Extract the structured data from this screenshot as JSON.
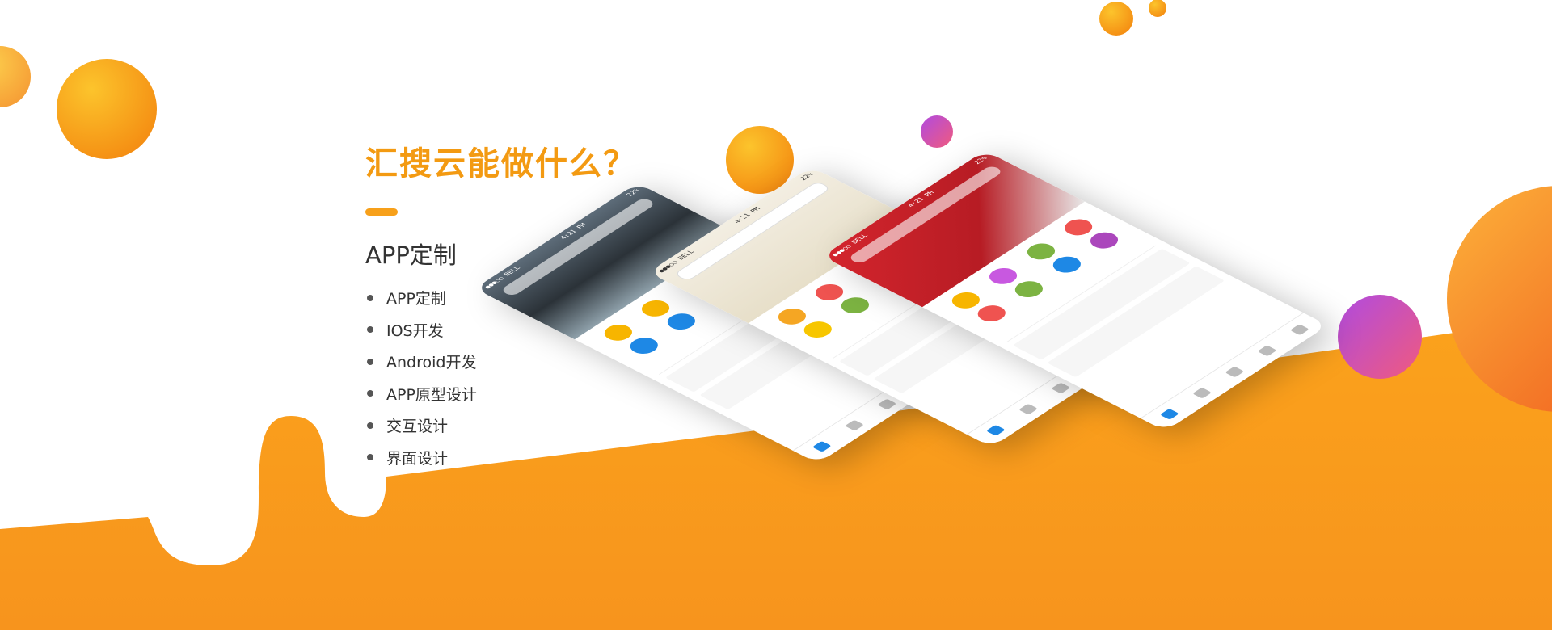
{
  "headline": "汇搜云能做什么？",
  "subtitle": "APP定制",
  "features": [
    "APP定制",
    "IOS开发",
    "Android开发",
    "APP原型设计",
    "交互设计",
    "界面设计"
  ],
  "colors": {
    "brand_orange": "#f7941d",
    "headline_orange": "#f39a12",
    "bubble_orange": "#fbb03b",
    "bubble_purple": "#9b3fd1",
    "app_red": "#d4252d",
    "tab_active_blue": "#1e88e5"
  },
  "phones": [
    {
      "status_left": "●●●○○ BELL",
      "status_time": "4:21 PM",
      "status_right": "22%",
      "tab_count": 5,
      "icon_colors": [
        "#f7b500",
        "#f7b500",
        "#f7b500",
        "#f7b500",
        "#1e88e5",
        "#1e88e5",
        "#1e88e5",
        "#1e88e5"
      ]
    },
    {
      "status_left": "●●●○○ BELL",
      "status_time": "4:21 PM",
      "status_right": "22%",
      "tab_count": 5,
      "icon_colors": [
        "#f5a623",
        "#ef5350",
        "#f5a623",
        "#26c6da",
        "#f7c600",
        "#7cb342",
        "#f5a623",
        "#7cb342"
      ]
    },
    {
      "status_left": "●●●○○ BELL",
      "status_time": "4:21 PM",
      "status_right": "22%",
      "tab_count": 5,
      "icon_colors": [
        "#f7b500",
        "#c858e0",
        "#7cb342",
        "#ef5350",
        "#ef5350",
        "#7cb342",
        "#1e88e5",
        "#ab47bc"
      ]
    }
  ]
}
